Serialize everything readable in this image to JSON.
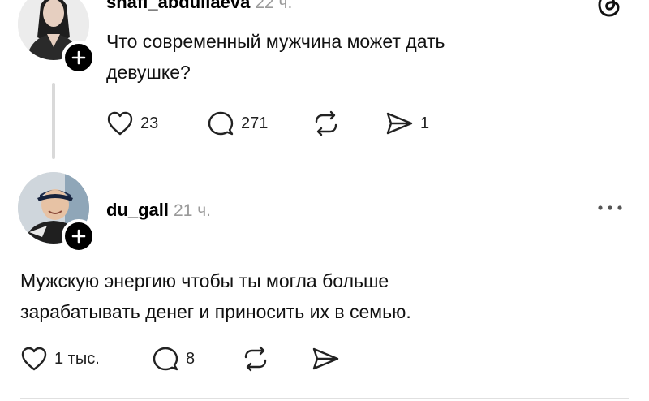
{
  "post1": {
    "username": "shafi_abdullaeva",
    "time": "22 ч.",
    "text_line1": "Что современный мужчина может дать",
    "text_line2": "девушке?",
    "likes": "23",
    "comments": "271",
    "shares": "1"
  },
  "post2": {
    "username": "du_gall",
    "time": "21 ч.",
    "text_line1": "Мужскую энергию чтобы ты могла больше",
    "text_line2": "зарабатывать денег и приносить их в семью.",
    "likes": "1 тыс.",
    "comments": "8"
  },
  "icons": {
    "logo": "threads-logo-icon",
    "more": "more-options-icon",
    "like": "heart-icon",
    "comment": "comment-icon",
    "repost": "repost-icon",
    "share": "send-icon",
    "follow": "plus-icon"
  },
  "colors": {
    "text": "#111111",
    "muted": "#9a9a9a",
    "line": "#d9d9d9"
  }
}
